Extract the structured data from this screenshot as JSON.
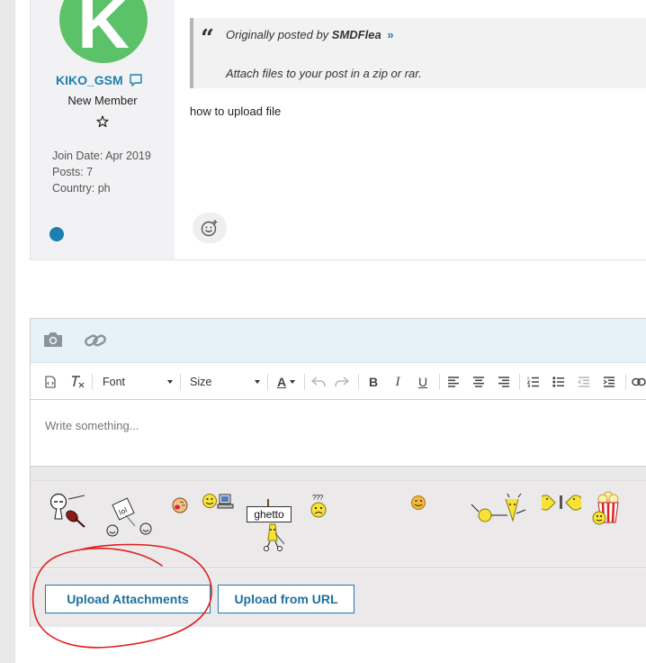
{
  "post": {
    "username": "KIKO_GSM",
    "avatar_letter": "K",
    "avatar_color": "#5cc26a",
    "rank": "New Member",
    "info": [
      "Join Date: Apr 2019",
      "Posts: 7",
      "Country: ph"
    ],
    "quote": {
      "prefix": "Originally posted by",
      "author": "SMDFlea",
      "jump": "»",
      "text": "Attach files to your post in a zip or rar."
    },
    "message": "how to upload file"
  },
  "editor": {
    "top_icons": [
      "camera-icon",
      "link-icon"
    ],
    "toolbar": {
      "font_label": "Font",
      "size_label": "Size",
      "color_label": "A",
      "bold": "B",
      "italic": "I",
      "underline": "U"
    },
    "placeholder": "Write something...",
    "smilies": [
      "violin",
      "lol-sign",
      "laugh",
      "two-faces-computer",
      "ghetto",
      "confused",
      "wink",
      "fishing",
      "pacman",
      "popcorn"
    ],
    "ghetto_text": "ghetto",
    "confused_text": "???",
    "buttons": {
      "upload_attachments": "Upload Attachments",
      "upload_url": "Upload from URL"
    }
  },
  "colors": {
    "link": "#1e7fae",
    "avatar": "#5cc26a",
    "online": "#1b7fb2",
    "editor_top": "#e6f1f8",
    "annotation": "#e02020"
  }
}
